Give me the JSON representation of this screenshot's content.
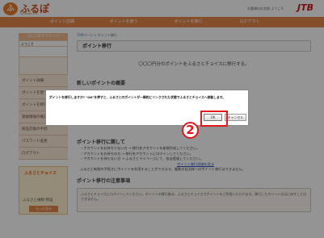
{
  "header": {
    "logo_text": "ふるぽ",
    "logo_sub": "furusato JTB",
    "greeting": "お客様のお名前 ようこそ",
    "brand": "JTB"
  },
  "nav": {
    "items": [
      "ポイント詳細",
      "ポイントを使う",
      "ポイントを移行",
      "ログアウト"
    ]
  },
  "sidebar": {
    "heading": "ID / JTBマイページ",
    "welcome": "ようこそ",
    "menu": [
      "ポイント詳細",
      "ポイントを使う",
      "ポイントを移行",
      "登録情報の確認",
      "商品交換の手続",
      "パスワード変更",
      "ログアウト"
    ],
    "banner_title": "ふるさとチョイス",
    "banner_sub": "ふるさと納税 特設",
    "banner_button": "もっと見る"
  },
  "main": {
    "breadcrumb": "TOPページ > ポイント移行",
    "title": "ポイント移行",
    "info_text": "〇〇〇円分のポイントをふるさとチョイスに移行する。",
    "sec1_title": "新しいポイントの概要",
    "sec2_title": "ポイント移行に関して",
    "sec2_lines": [
      "・アカウントをお持ちでない方 → 移行先アカウントを新規作成してください。",
      "・アカウントをお持ちの方 → 移行先アカウントにログインしてください。",
      "・アカウントを持たない方 → ふるさとマイページにて、各自登録してください。"
    ],
    "link_text": "ポイント移行詳細を見る",
    "sec2_para": "ふるさと納税の手続きにポイントを利用することができます。複数の自治体へのポイント移行はできません。",
    "sec3_title": "ポイント移行の注意事項",
    "notice": "ふるさとチョイスにログインしてください。ポイントの移行後は、ふるさとチョイスでポイントをご利用いただけます。移行したポイントは元に戻すことはできません。"
  },
  "dialog": {
    "message": "ポイントを移行しますか? \"OK\"を押すと、ふるさとのポイントが一瞬的にリンクされた状態でふるさとチョイスへ移動します。",
    "ok_label": "OK",
    "cancel_label": "キャンセル"
  },
  "annotation": {
    "step_number": "2"
  },
  "colors": {
    "nav": "#e6874a",
    "highlight": "#e0191f"
  }
}
